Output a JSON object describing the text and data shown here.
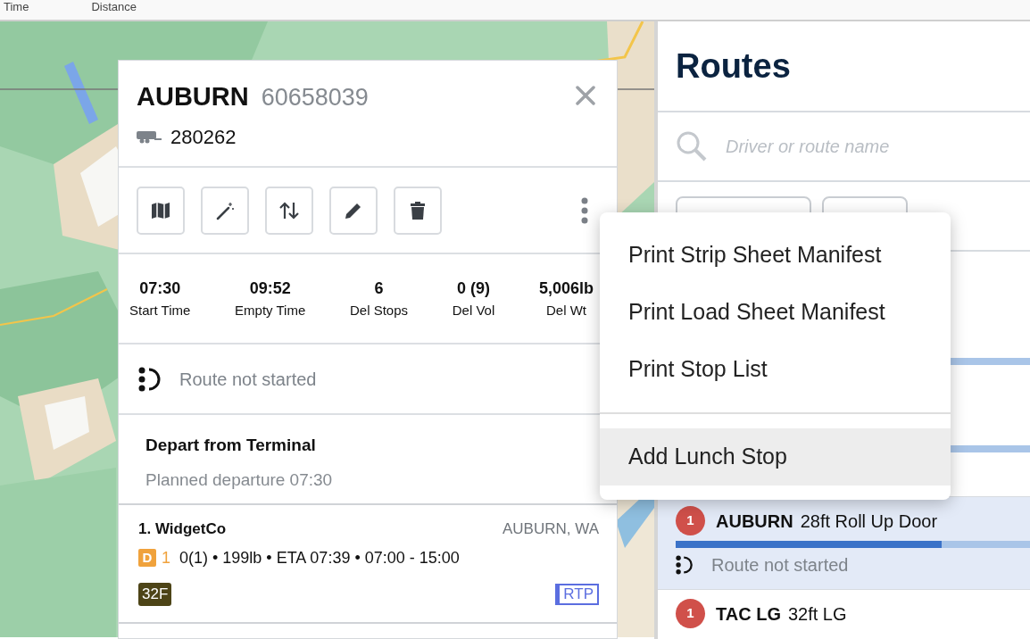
{
  "top_tabs": [
    {
      "label": "Time"
    },
    {
      "label": "Distance"
    }
  ],
  "route_card": {
    "title": "AUBURN",
    "route_id": "60658039",
    "truck_id": "280262",
    "stats": [
      {
        "value": "07:30",
        "label": "Start Time"
      },
      {
        "value": "09:52",
        "label": "Empty Time"
      },
      {
        "value": "6",
        "label": "Del Stops"
      },
      {
        "value": "0 (9)",
        "label": "Del Vol"
      },
      {
        "value": "5,006lb",
        "label": "Del Wt"
      }
    ],
    "status": "Route not started",
    "depart": {
      "title": "Depart from Terminal",
      "subtitle": "Planned departure 07:30"
    },
    "stops": [
      {
        "name": "1. WidgetCo",
        "city": "AUBURN, WA",
        "type_badge": "D",
        "count": "1",
        "details": "0(1) • 199lb • ETA 07:39 • 07:00 - 15:00",
        "tag": "32F",
        "code": "RTP"
      }
    ]
  },
  "menu": {
    "groups": [
      [
        {
          "label": "Print Strip Sheet Manifest",
          "highlighted": false
        },
        {
          "label": "Print Load Sheet Manifest",
          "highlighted": false
        },
        {
          "label": "Print Stop List",
          "highlighted": false
        }
      ],
      [
        {
          "label": "Add Lunch Stop",
          "highlighted": true
        }
      ]
    ]
  },
  "routes_panel": {
    "title": "Routes",
    "search": {
      "placeholder": "Driver or route name"
    },
    "routes": [
      {
        "badge": "1",
        "name": "AUBURN",
        "vehicle": "28ft Roll Up Door",
        "level": 0.75,
        "status": "Route not started",
        "selected": true
      },
      {
        "badge": "1",
        "name": "TAC LG",
        "vehicle": "32ft LG",
        "selected": false
      }
    ]
  }
}
